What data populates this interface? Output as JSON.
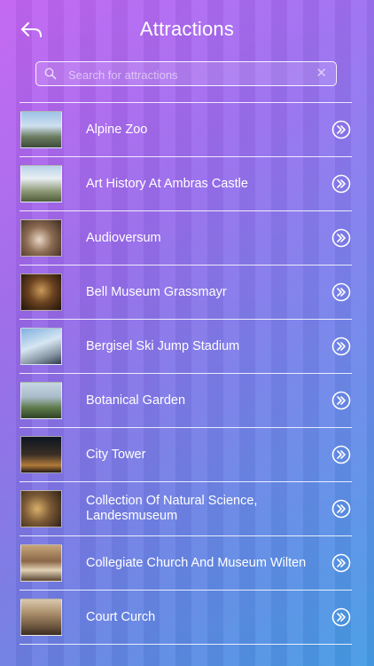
{
  "header": {
    "title": "Attractions"
  },
  "search": {
    "placeholder": "Search for attractions",
    "value": ""
  },
  "attractions": [
    {
      "name": "Alpine Zoo"
    },
    {
      "name": "Art History At Ambras Castle"
    },
    {
      "name": "Audioversum"
    },
    {
      "name": "Bell Museum Grassmayr"
    },
    {
      "name": "Bergisel Ski Jump Stadium"
    },
    {
      "name": "Botanical Garden"
    },
    {
      "name": "City Tower"
    },
    {
      "name": "Collection Of Natural Science, Landesmuseum"
    },
    {
      "name": "Collegiate Church And Museum Wilten"
    },
    {
      "name": "Court Curch"
    }
  ],
  "icons": {
    "back": "back-arrow-icon",
    "search": "search-icon",
    "clear": "close-icon",
    "row_arrow": "double-chevron-right-circle-icon"
  },
  "colors": {
    "gradient_start": "#c05ef0",
    "gradient_end": "#4aa8f6",
    "text": "#ffffff"
  }
}
